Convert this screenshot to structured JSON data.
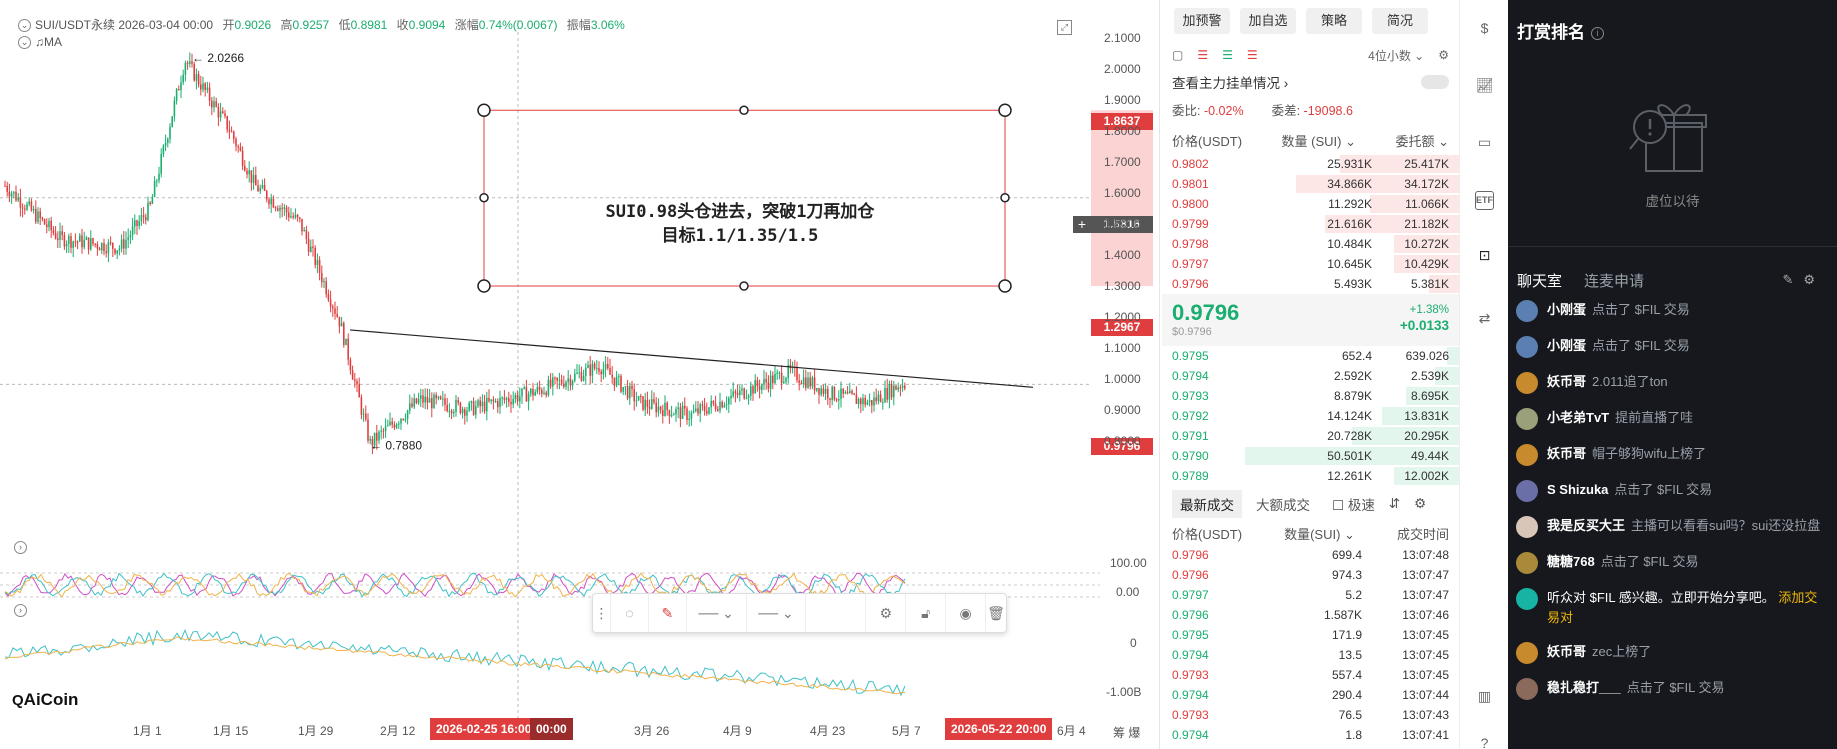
{
  "chart": {
    "symbol": "SUI/USDT永续",
    "date": "2026-03-04 00:00",
    "open_label": "开",
    "open": "0.9026",
    "high_label": "高",
    "high": "0.9257",
    "low_label": "低",
    "low": "0.8981",
    "close_label": "收",
    "close": "0.9094",
    "change_label": "涨幅",
    "change": "0.74%(0.0067)",
    "amplitude_label": "振幅",
    "amplitude": "3.06%",
    "ma_label": "MA",
    "high_marker": "2.0266",
    "low_marker": "0.7880",
    "annotation_line1": "SUI0.98头仓进去，突破1刀再加仓",
    "annotation_line2": "目标1.1/1.35/1.5",
    "box_top_price": "1.8637",
    "box_mid_price": "1.5816",
    "box_bottom_price": "1.2967",
    "current_price": "0.9796",
    "y_axis": [
      "2.1000",
      "2.0000",
      "1.9000",
      "1.8000",
      "1.7000",
      "1.6000",
      "1.5000",
      "1.4000",
      "1.3000",
      "1.2000",
      "1.1000",
      "1.0000",
      "0.9000",
      "0.8000"
    ],
    "osc1_axis": [
      "100.00",
      "0.00"
    ],
    "osc2_axis": [
      "0",
      "-1.00B"
    ],
    "x_axis": [
      "1月 1",
      "1月 15",
      "1月 29",
      "2月 12",
      "3月 26",
      "4月 9",
      "4月 23",
      "5月 7",
      "6月 4"
    ],
    "x_tag_left": "2026-02-25 16:00",
    "x_tag_left_small": "00:00",
    "x_tag_right": "2026-05-22 20:00",
    "logo": "AiCoin",
    "axis_corner": "筹  爆",
    "colors": {
      "up": "#1aae6f",
      "down": "#e03e3e",
      "box": "#e03e3e"
    }
  },
  "toolbar": {
    "icons": [
      "drag-handle-icon",
      "magnet-icon",
      "pencil-icon",
      "line-style-icon",
      "line-width-icon",
      "settings-icon",
      "lock-icon",
      "eye-icon",
      "trash-icon"
    ]
  },
  "orderbook": {
    "buttons": [
      "加预警",
      "加自选",
      "策略",
      "简况"
    ],
    "decimals": "4位小数",
    "main_orders": "查看主力挂单情况",
    "ratio_label": "委比:",
    "ratio": "-0.02%",
    "diff_label": "委差:",
    "diff": "-19098.6",
    "col_price": "价格(USDT)",
    "col_qty": "数量 (SUI)",
    "col_amount": "委托额",
    "asks": [
      {
        "p": "0.9802",
        "q": "25.931K",
        "t": "25.417K",
        "w": 40
      },
      {
        "p": "0.9801",
        "q": "34.866K",
        "t": "34.172K",
        "w": 55
      },
      {
        "p": "0.9800",
        "q": "11.292K",
        "t": "11.066K",
        "w": 30
      },
      {
        "p": "0.9799",
        "q": "21.616K",
        "t": "21.182K",
        "w": 45
      },
      {
        "p": "0.9798",
        "q": "10.484K",
        "t": "10.272K",
        "w": 22
      },
      {
        "p": "0.9797",
        "q": "10.645K",
        "t": "10.429K",
        "w": 22
      },
      {
        "p": "0.9796",
        "q": "5.493K",
        "t": "5.381K",
        "w": 10
      }
    ],
    "last_price": "0.9796",
    "last_price_usd": "$0.9796",
    "change_pct": "+1.38%",
    "change_abs": "+0.0133",
    "bids": [
      {
        "p": "0.9795",
        "q": "652.4",
        "t": "639.026",
        "w": 4
      },
      {
        "p": "0.9794",
        "q": "2.592K",
        "t": "2.539K",
        "w": 8
      },
      {
        "p": "0.9793",
        "q": "8.879K",
        "t": "8.695K",
        "w": 18
      },
      {
        "p": "0.9792",
        "q": "14.124K",
        "t": "13.831K",
        "w": 26
      },
      {
        "p": "0.9791",
        "q": "20.728K",
        "t": "20.295K",
        "w": 36
      },
      {
        "p": "0.9790",
        "q": "50.501K",
        "t": "49.44K",
        "w": 72
      },
      {
        "p": "0.9789",
        "q": "12.261K",
        "t": "12.002K",
        "w": 22
      }
    ],
    "tab_latest": "最新成交",
    "tab_large": "大额成交",
    "fast_label": "极速",
    "trade_col_price": "价格(USDT)",
    "trade_col_qty": "数量(SUI)",
    "trade_col_time": "成交时间",
    "trades": [
      {
        "p": "0.9796",
        "q": "699.4",
        "t": "13:07:48",
        "c": "red"
      },
      {
        "p": "0.9796",
        "q": "974.3",
        "t": "13:07:47",
        "c": "red"
      },
      {
        "p": "0.9797",
        "q": "5.2",
        "t": "13:07:47",
        "c": "green"
      },
      {
        "p": "0.9796",
        "q": "1.587K",
        "t": "13:07:46",
        "c": "green"
      },
      {
        "p": "0.9795",
        "q": "171.9",
        "t": "13:07:45",
        "c": "green"
      },
      {
        "p": "0.9794",
        "q": "13.5",
        "t": "13:07:45",
        "c": "green"
      },
      {
        "p": "0.9793",
        "q": "557.4",
        "t": "13:07:45",
        "c": "red"
      },
      {
        "p": "0.9794",
        "q": "290.4",
        "t": "13:07:44",
        "c": "green"
      },
      {
        "p": "0.9793",
        "q": "76.5",
        "t": "13:07:43",
        "c": "red"
      },
      {
        "p": "0.9794",
        "q": "1.8",
        "t": "13:07:41",
        "c": "green"
      }
    ]
  },
  "side_strip": {
    "icons": [
      "dollar-icon",
      "chart-trend-icon",
      "monitor-icon",
      "etf-icon",
      "robot-icon",
      "swap-icon",
      "layout-icon",
      "help-icon"
    ]
  },
  "dark_panel": {
    "reward_title": "打赏排名",
    "reward_empty": "虚位以待",
    "tab_chat": "聊天室",
    "tab_mic": "连麦申请",
    "messages": [
      {
        "name": "小刚蛋",
        "text": "点击了 $FIL 交易",
        "hl": "",
        "av": "#5b7fb0"
      },
      {
        "name": "小刚蛋",
        "text": "点击了 $FIL 交易",
        "hl": "",
        "av": "#5b7fb0"
      },
      {
        "name": "妖币哥",
        "text": "2.011追了ton",
        "hl": "",
        "av": "#c78a2c"
      },
      {
        "name": "小老弟TvT",
        "text": "提前直播了哇",
        "hl": "",
        "av": "#9aa07a"
      },
      {
        "name": "妖币哥",
        "text": "帽子够狗wifu上榜了",
        "hl": "",
        "av": "#c78a2c"
      },
      {
        "name": "S Shizuka",
        "text": "点击了 $FIL 交易",
        "hl": "",
        "av": "#6a6fa8"
      },
      {
        "name": "我是反买大王",
        "text": "主播可以看看sui吗？sui还没拉盘",
        "hl": "",
        "av": "#d8c7b8"
      },
      {
        "name": "糖糖768",
        "text": "点击了 $FIL 交易",
        "hl": "",
        "av": "#a88a3a"
      },
      {
        "name": "",
        "text": "听众对 $FIL 感兴趣。立即开始分享吧。",
        "hl": "添加交易对",
        "av": "#17b3a3"
      },
      {
        "name": "妖币哥",
        "text": "zec上榜了",
        "hl": "",
        "av": "#c78a2c"
      },
      {
        "name": "稳扎稳打___",
        "text": "点击了 $FIL 交易",
        "hl": "",
        "av": "#8a6a5a"
      }
    ]
  }
}
